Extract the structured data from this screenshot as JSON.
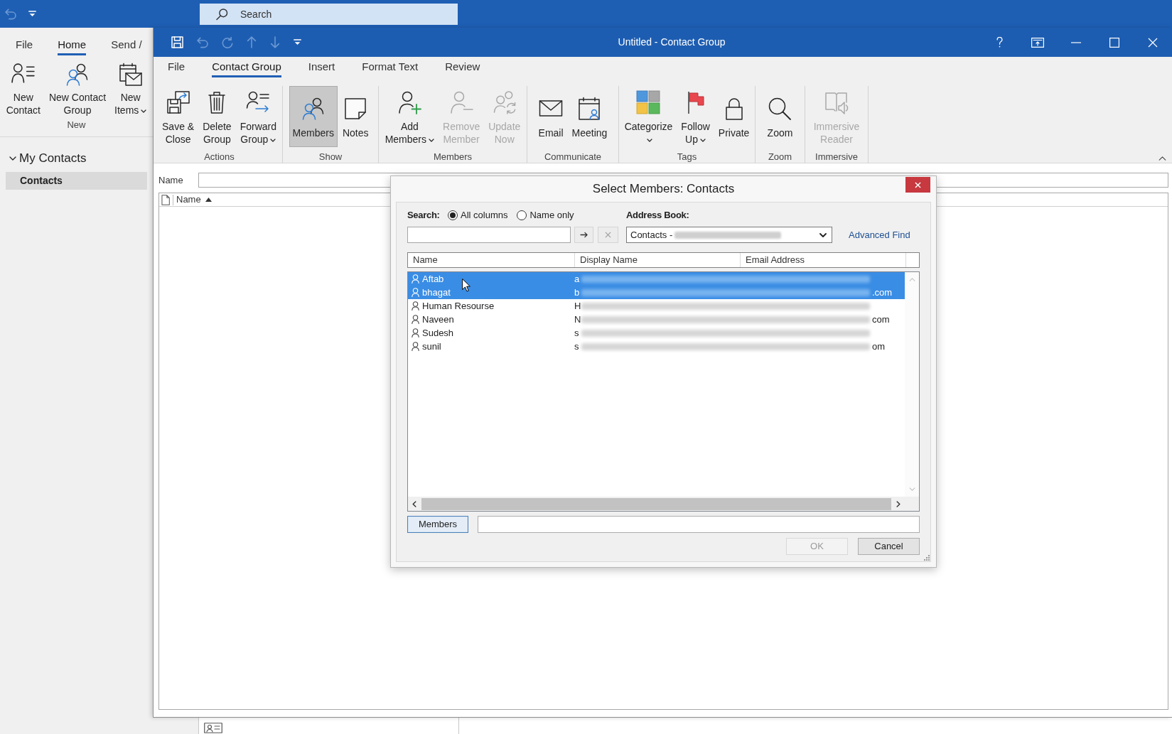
{
  "main_window": {
    "quick_access": [
      {
        "disabled": true
      },
      {
        "disabled": false
      }
    ],
    "search": {
      "placeholder": "Search"
    },
    "tabs": [
      {
        "label": "File",
        "selected": false
      },
      {
        "label": "Home",
        "selected": true
      },
      {
        "label": "Send /",
        "selected": false
      }
    ],
    "ribbon_groups": [
      {
        "label": "New",
        "buttons": [
          {
            "lines": [
              "New",
              "Contact"
            ],
            "dropdown": false
          },
          {
            "lines": [
              "New Contact",
              "Group"
            ],
            "dropdown": false
          },
          {
            "lines": [
              "New",
              "Items"
            ],
            "dropdown": true
          }
        ]
      }
    ],
    "folders": [
      {
        "label": "My Contacts",
        "expanded": true,
        "children": [
          {
            "label": "Contacts",
            "selected": true
          }
        ]
      }
    ]
  },
  "contact_group_window": {
    "title": "Untitled - Contact Group",
    "quick_access": [
      {
        "disabled": false
      },
      {
        "disabled": true
      },
      {
        "disabled": true
      },
      {
        "disabled": true
      },
      {
        "disabled": true
      },
      {
        "disabled": false
      }
    ],
    "tabs": [
      {
        "label": "File",
        "selected": false
      },
      {
        "label": "Contact Group",
        "selected": true
      },
      {
        "label": "Insert",
        "selected": false
      },
      {
        "label": "Format Text",
        "selected": false
      },
      {
        "label": "Review",
        "selected": false
      }
    ],
    "ribbon_groups": [
      {
        "label": "Actions",
        "buttons": [
          {
            "lines": [
              "Save &",
              "Close"
            ],
            "dropdown": false,
            "disabled": false
          },
          {
            "lines": [
              "Delete",
              "Group"
            ],
            "dropdown": false,
            "disabled": false
          },
          {
            "lines": [
              "Forward",
              "Group"
            ],
            "dropdown": true,
            "disabled": false
          }
        ]
      },
      {
        "label": "Show",
        "buttons": [
          {
            "lines": [
              "Members"
            ],
            "dropdown": false,
            "disabled": false,
            "selected": true
          },
          {
            "lines": [
              "Notes"
            ],
            "dropdown": false,
            "disabled": false,
            "selected": false
          }
        ]
      },
      {
        "label": "Members",
        "buttons": [
          {
            "lines": [
              "Add",
              "Members"
            ],
            "dropdown": true,
            "disabled": false
          },
          {
            "lines": [
              "Remove",
              "Member"
            ],
            "dropdown": false,
            "disabled": true
          },
          {
            "lines": [
              "Update",
              "Now"
            ],
            "dropdown": false,
            "disabled": true
          }
        ]
      },
      {
        "label": "Communicate",
        "buttons": [
          {
            "lines": [
              "Email"
            ],
            "dropdown": false,
            "disabled": false
          },
          {
            "lines": [
              "Meeting"
            ],
            "dropdown": false,
            "disabled": false
          }
        ]
      },
      {
        "label": "Tags",
        "buttons": [
          {
            "lines": [
              "Categorize"
            ],
            "dropdown": true,
            "disabled": false
          },
          {
            "lines": [
              "Follow",
              "Up"
            ],
            "dropdown": true,
            "disabled": false
          },
          {
            "lines": [
              "Private"
            ],
            "dropdown": false,
            "disabled": false
          }
        ]
      },
      {
        "label": "Zoom",
        "buttons": [
          {
            "lines": [
              "Zoom"
            ],
            "dropdown": false,
            "disabled": false
          }
        ]
      },
      {
        "label": "Immersive",
        "buttons": [
          {
            "lines": [
              "Immersive",
              "Reader"
            ],
            "dropdown": false,
            "disabled": true
          }
        ]
      }
    ],
    "name_field": {
      "label": "Name"
    },
    "member_list": {
      "columns": [
        {
          "label": "Name",
          "sorted_ascending": true
        }
      ]
    }
  },
  "dialog": {
    "title": "Select Members: Contacts",
    "search_label": "Search:",
    "search_scope": [
      {
        "label": "All columns",
        "selected": true
      },
      {
        "label": "Name only",
        "selected": false
      }
    ],
    "address_book_label": "Address Book:",
    "address_book": {
      "value": "Contacts -",
      "redacted": true
    },
    "advanced_find": "Advanced Find",
    "columns": [
      "Name",
      "Display Name",
      "Email Address"
    ],
    "rows": [
      {
        "name": "Aftab",
        "display_name": "a",
        "selected": true,
        "redacted": true
      },
      {
        "name": "bhagat",
        "display_name": "b",
        "email": ".com",
        "selected": true,
        "redacted": true
      },
      {
        "name": "Human Resourse",
        "display_name": "H",
        "selected": false,
        "redacted": true
      },
      {
        "name": "Naveen",
        "display_name": "N",
        "email": "com",
        "selected": false,
        "redacted": true
      },
      {
        "name": "Sudesh",
        "display_name": "s",
        "selected": false,
        "redacted": true
      },
      {
        "name": "sunil",
        "display_name": "s",
        "email": "om",
        "selected": false,
        "redacted": true
      }
    ],
    "members_button": "Members",
    "buttons": [
      {
        "label": "OK",
        "disabled": true
      },
      {
        "label": "Cancel",
        "disabled": false
      }
    ]
  }
}
